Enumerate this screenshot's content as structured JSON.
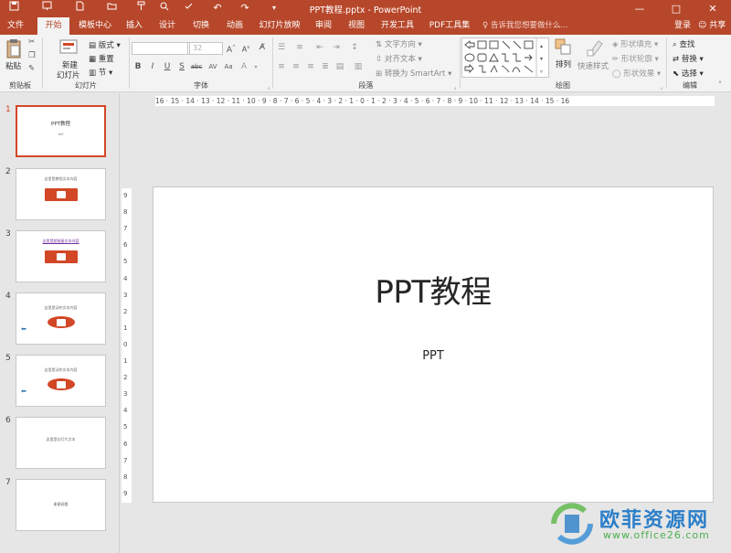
{
  "window": {
    "title": "PPT教程.pptx - PowerPoint",
    "minimize": "—",
    "maximize": "□",
    "close": "✕"
  },
  "tabs": [
    "文件",
    "开始",
    "模板中心",
    "插入",
    "设计",
    "切换",
    "动画",
    "幻灯片放映",
    "审阅",
    "视图",
    "开发工具",
    "PDF工具集"
  ],
  "active_tab": "开始",
  "tell_me": "告诉我您想要做什么...",
  "login": "登录",
  "share": "共享",
  "ribbon": {
    "clipboard": {
      "paste": "粘贴",
      "group": "剪贴板"
    },
    "slides": {
      "new_slide_line1": "新建",
      "new_slide_line2": "幻灯片",
      "layout": "版式",
      "reset": "重置",
      "section": "节",
      "group": "幻灯片"
    },
    "font": {
      "font_name": "",
      "font_size": "32",
      "group": "字体"
    },
    "paragraph": {
      "text_direction": "文字方向",
      "align_text": "对齐文本",
      "smartart": "转换为 SmartArt",
      "group": "段落"
    },
    "drawing": {
      "arrange": "排列",
      "quick_styles": "快速样式",
      "shape_fill": "形状填充",
      "shape_outline": "形状轮廓",
      "shape_effects": "形状效果",
      "group": "绘图"
    },
    "editing": {
      "find": "查找",
      "replace": "替换",
      "select": "选择",
      "group": "编辑"
    }
  },
  "slides_panel": [
    {
      "num": "1",
      "text": "PPT教程",
      "sub": "PPT"
    },
    {
      "num": "2",
      "text": "这里是教程文本内容"
    },
    {
      "num": "3",
      "text": "这里是超链接文本内容"
    },
    {
      "num": "4",
      "text": "这里是动作文本内容"
    },
    {
      "num": "5",
      "text": "这里是动作文本内容"
    },
    {
      "num": "6",
      "text": "这里是幻灯片文本"
    },
    {
      "num": "7",
      "text": "谢谢观看"
    }
  ],
  "h_ruler": "16 · 15 · 14 · 13 · 12 · 11 · 10 · 9 · 8 · 7 · 6 · 5 · 4 · 3 · 2 · 1 · 0 · 1 · 2 · 3 · 4 · 5 · 6 · 7 · 8 · 9 · 10 · 11 · 12 · 13 · 14 · 15 · 16",
  "v_ruler": [
    "9",
    "8",
    "7",
    "6",
    "5",
    "4",
    "3",
    "2",
    "1",
    "0",
    "1",
    "2",
    "3",
    "4",
    "5",
    "6",
    "7",
    "8",
    "9"
  ],
  "slide": {
    "title": "PPT教程",
    "subtitle": "PPT"
  },
  "watermark": {
    "name": "欧菲资源网",
    "url": "www.office26.com"
  },
  "colors": {
    "accent": "#b7472a",
    "selected": "#d24726"
  }
}
